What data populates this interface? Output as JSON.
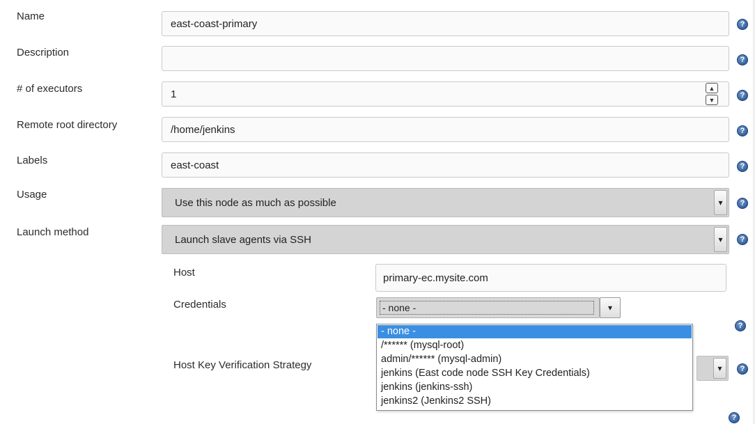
{
  "form": {
    "name": {
      "label": "Name",
      "value": "east-coast-primary"
    },
    "description": {
      "label": "Description",
      "value": ""
    },
    "executors": {
      "label": "# of executors",
      "value": "1"
    },
    "remote_root": {
      "label": "Remote root directory",
      "value": "/home/jenkins"
    },
    "labels": {
      "label": "Labels",
      "value": "east-coast"
    },
    "usage": {
      "label": "Usage",
      "value": "Use this node as much as possible"
    },
    "launch_method": {
      "label": "Launch method",
      "value": "Launch slave agents via SSH"
    }
  },
  "ssh": {
    "host": {
      "label": "Host",
      "value": "primary-ec.mysite.com"
    },
    "credentials": {
      "label": "Credentials",
      "value": "- none -",
      "options": [
        "- none -",
        "/****** (mysql-root)",
        "admin/****** (mysql-admin)",
        "jenkins (East code node SSH Key Credentials)",
        "jenkins (jenkins-ssh)",
        "jenkins2 (Jenkins2 SSH)"
      ]
    },
    "host_key_strategy": {
      "label": "Host Key Verification Strategy"
    }
  },
  "icons": {
    "help": "?",
    "dropdown_arrow": "▾",
    "spinner_up": "▲",
    "spinner_down": "▼"
  }
}
